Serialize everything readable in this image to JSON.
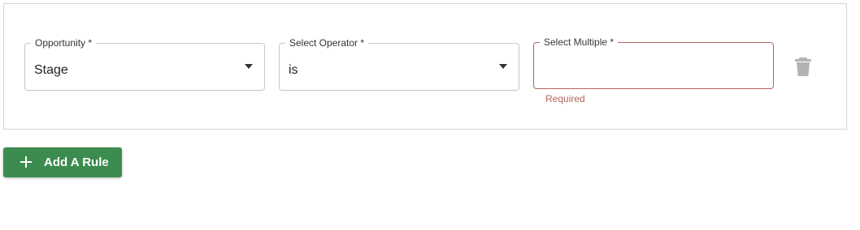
{
  "rule": {
    "opportunity_field": {
      "label": "Opportunity *",
      "value": "Stage"
    },
    "operator_field": {
      "label": "Select Operator *",
      "value": "is"
    },
    "multiple_field": {
      "label": "Select Multiple *",
      "value": "",
      "error": "Required"
    },
    "delete_icon": "trash-icon"
  },
  "actions": {
    "add_rule_label": "Add A Rule",
    "add_rule_icon": "plus-icon"
  },
  "colors": {
    "primary_button": "#3d8c4f",
    "error": "#b4655a",
    "border": "#c8c8c8"
  }
}
